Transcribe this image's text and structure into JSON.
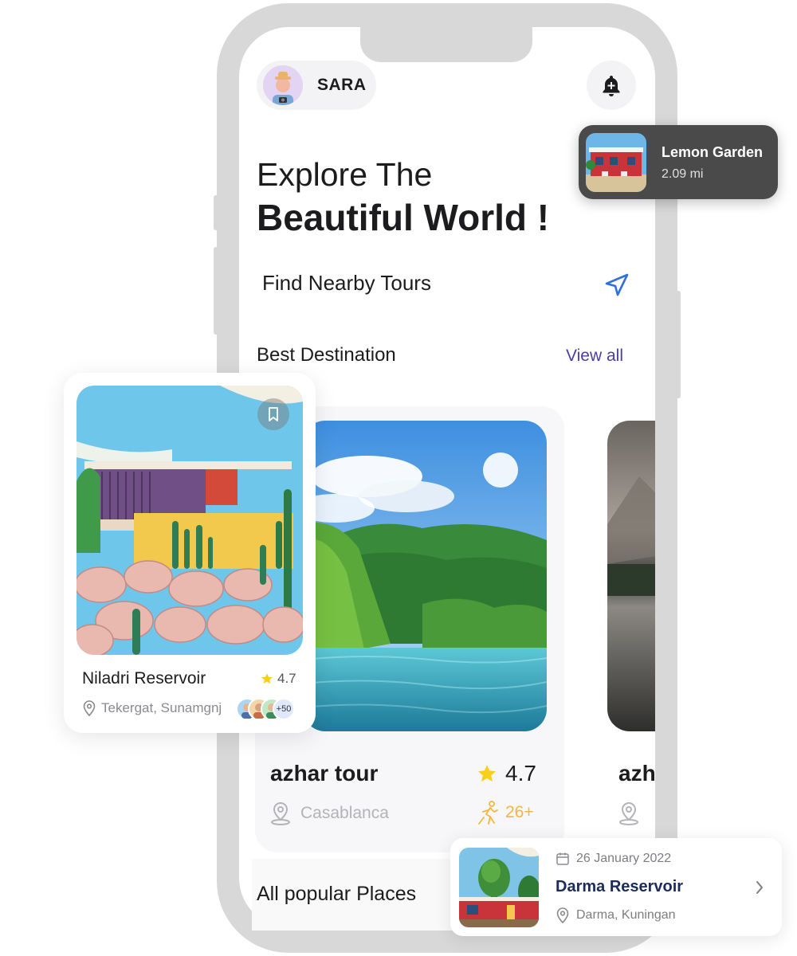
{
  "user": {
    "name": "SARA"
  },
  "headline": {
    "line1": "Explore The",
    "line2": "Beautiful World !"
  },
  "nearby": {
    "label": "Find Nearby Tours"
  },
  "best_destination": {
    "title": "Best Destination",
    "view_all": "View all",
    "main_card": {
      "name": "azhar tour",
      "rating": "4.7",
      "location": "Casablanca",
      "visitors": "26+"
    },
    "partial_card": {
      "name": "azh"
    }
  },
  "popular": {
    "title": "All popular Places"
  },
  "featured_card": {
    "name": "Niladri Reservoir",
    "rating": "4.7",
    "location": "Tekergat, Sunamgnj",
    "visitor_count": "+50"
  },
  "toast": {
    "title": "Lemon Garden",
    "distance": "2.09 mi"
  },
  "event_card": {
    "date": "26 January 2022",
    "title": "Darma Reservoir",
    "location": "Darma, Kuningan"
  },
  "colors": {
    "accent": "#4a3f9f",
    "nav_icon": "#2f6fe0",
    "star": "#f9cf1b",
    "visitors": "#f6b53f",
    "toast_bg": "#4a4a4a"
  },
  "icons": {
    "notification": "bell-plus-icon",
    "navigate": "navigation-arrow-icon",
    "star": "star-icon",
    "location": "map-pin-icon",
    "visitors": "walking-person-icon",
    "bookmark": "bookmark-icon",
    "calendar": "calendar-icon",
    "chevron": "chevron-right-icon"
  }
}
